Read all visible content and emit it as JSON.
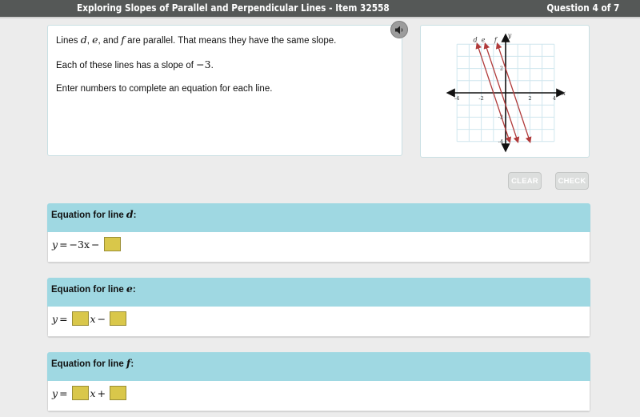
{
  "header": {
    "title": "Exploring Slopes of Parallel and Perpendicular Lines - Item 32558",
    "question_counter": "Question 4 of 7"
  },
  "prompt": {
    "line1_pre": "Lines ",
    "var_d": "d",
    "sep1": ", ",
    "var_e": "e",
    "sep2": ", and ",
    "var_f": "f",
    "line1_post": " are parallel. That means they have the same slope.",
    "line2_pre": "Each of these lines has a slope of ",
    "line2_slope": "−3",
    "line2_post": ".",
    "line3": "Enter numbers to complete an equation for each line."
  },
  "audio_button": {
    "icon": "speaker-icon"
  },
  "graph": {
    "x_axis_label": "x",
    "y_axis_label": "y",
    "x_range": [
      -4,
      4
    ],
    "y_range": [
      -4,
      4
    ],
    "x_tick_labels": [
      "-4",
      "-2",
      "2",
      "4"
    ],
    "y_tick_labels": [
      "2",
      "-2",
      "-4"
    ],
    "line_color": "#b03a3a",
    "lines": [
      {
        "name": "d",
        "slope": -3,
        "intercept": -3
      },
      {
        "name": "e",
        "slope": -3,
        "intercept": -1
      },
      {
        "name": "f",
        "slope": -3,
        "intercept": 2
      }
    ]
  },
  "buttons": {
    "clear": "CLEAR",
    "check": "CHECK"
  },
  "equations": [
    {
      "header_pre": "Equation for line ",
      "var": "d",
      "header_post": ":",
      "parts": [
        "y",
        "=",
        "−3x",
        "−"
      ],
      "answer_box_value": ""
    },
    {
      "header_pre": "Equation for line ",
      "var": "e",
      "header_post": ":",
      "parts": [
        "y",
        "=",
        "x",
        "−"
      ],
      "slope_box_value": "",
      "intercept_box_value": ""
    },
    {
      "header_pre": "Equation for line ",
      "var": "f",
      "header_post": ":",
      "parts": [
        "y",
        "=",
        "x",
        "+"
      ],
      "slope_box_value": "",
      "intercept_box_value": ""
    }
  ],
  "colors": {
    "topbar": "#555857",
    "equation_header": "#9fd8e2",
    "answer_box": "#d9c74a",
    "graph_grid": "#cfe6ee"
  }
}
